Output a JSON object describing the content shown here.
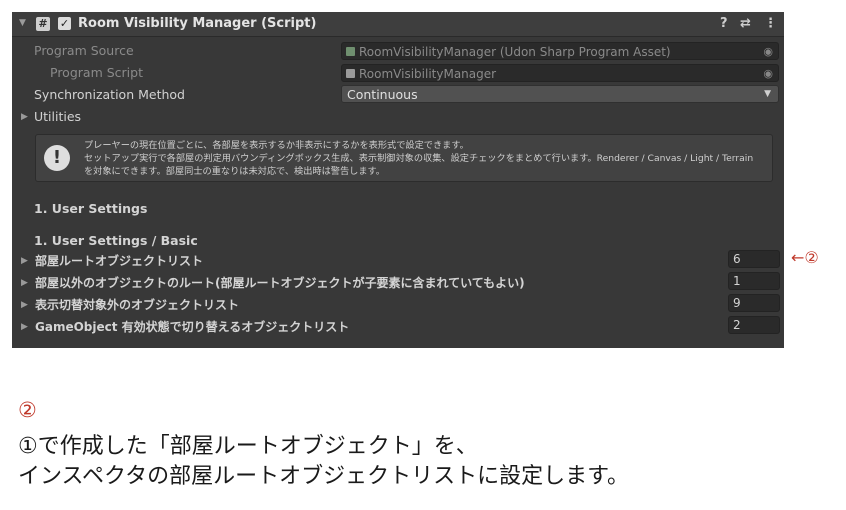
{
  "header": {
    "title": "Room Visibility Manager (Script)",
    "icon_hash": "#",
    "check": "✓",
    "help_icon": "?",
    "settings_icon": "⇄",
    "menu_icon": "⋮"
  },
  "fields": {
    "program_source_label": "Program Source",
    "program_source_value": "RoomVisibilityManager (Udon Sharp Program Asset)",
    "program_script_label": "Program Script",
    "program_script_value": "RoomVisibilityManager",
    "sync_label": "Synchronization Method",
    "sync_value": "Continuous",
    "utilities_label": "Utilities"
  },
  "help": {
    "line1": "プレーヤーの現在位置ごとに、各部屋を表示するか非表示にするかを表形式で設定できます。",
    "line2": "セットアップ実行で各部屋の判定用バウンディングボックス生成、表示制御対象の収集、設定チェックをまとめて行います。Renderer / Canvas / Light / Terrain",
    "line3": "を対象にできます。部屋同士の重なりは未対応で、検出時は警告します。"
  },
  "sections": {
    "s1": "1. User Settings",
    "s2": "1. User Settings / Basic"
  },
  "lists": [
    {
      "label": "部屋ルートオブジェクトリスト",
      "count": "6"
    },
    {
      "label": "部屋以外のオブジェクトのルート(部屋ルートオブジェクトが子要素に含まれていてもよい)",
      "count": "1"
    },
    {
      "label": "表示切替対象外のオブジェクトリスト",
      "count": "9"
    },
    {
      "label": "GameObject 有効状態で切り替えるオブジェクトリスト",
      "count": "2"
    }
  ],
  "annotation": {
    "arrow": "←②",
    "num": "②",
    "line1": "①で作成した「部屋ルートオブジェクト」を、",
    "line2": "インスペクタの部屋ルートオブジェクトリストに設定します。"
  },
  "colors": {
    "accent": "#c0392b",
    "panel_bg": "#383838"
  }
}
